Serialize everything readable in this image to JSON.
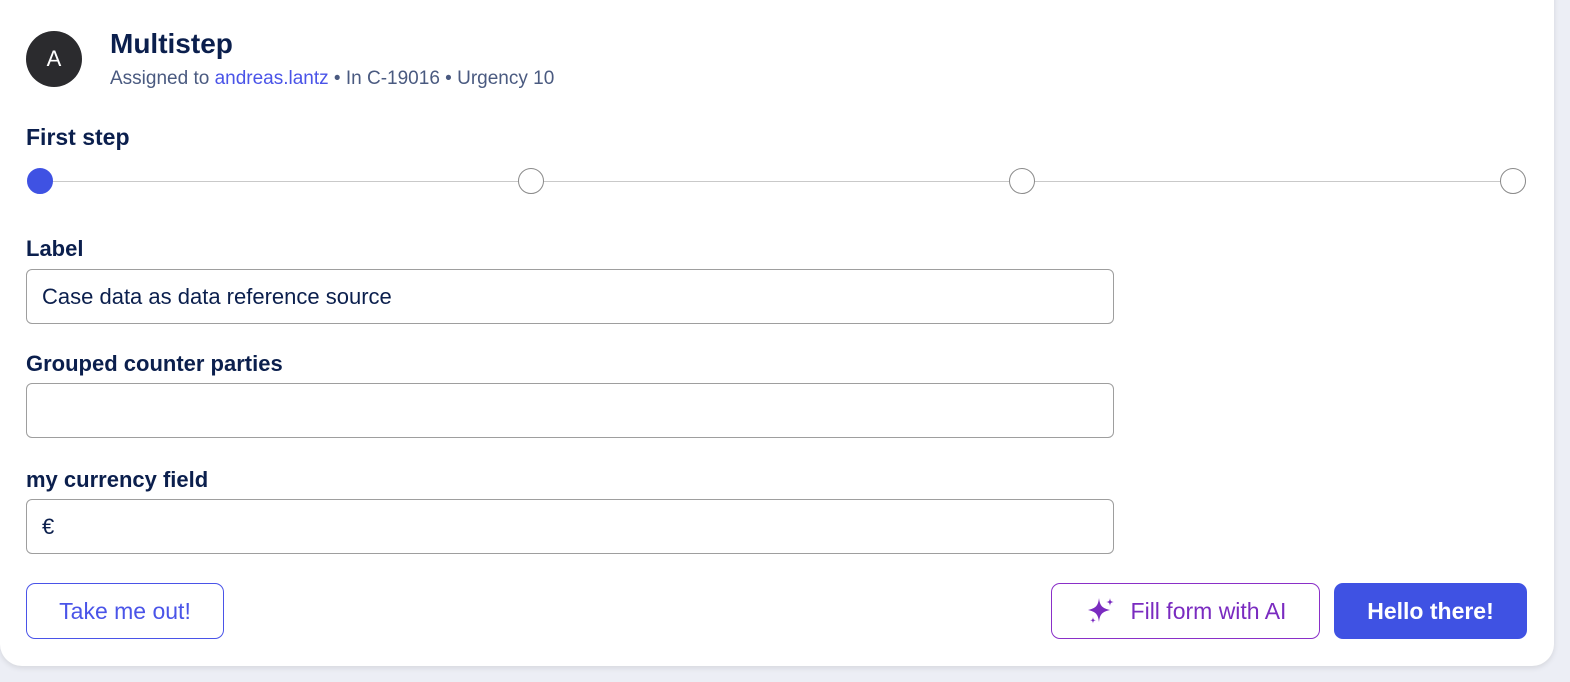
{
  "header": {
    "avatar_initial": "A",
    "title": "Multistep",
    "assigned_prefix": "Assigned to ",
    "assignee": "andreas.lantz",
    "separator1": " • ",
    "case_ref": "In C-19016",
    "separator2": " • ",
    "urgency": "Urgency 10"
  },
  "stepper": {
    "current_step_title": "First step",
    "steps_count": 4,
    "active_index": 0,
    "active_color": "#3f52e3"
  },
  "form": {
    "label_field": {
      "label": "Label",
      "value": "Case data as data reference source"
    },
    "grouped_field": {
      "label": "Grouped counter parties",
      "value": ""
    },
    "currency_field": {
      "label": "my currency field",
      "symbol": "€",
      "value": ""
    }
  },
  "actions": {
    "take_out_label": "Take me out!",
    "fill_ai_label": "Fill form with AI",
    "primary_label": "Hello there!"
  },
  "colors": {
    "accent": "#3f52e3",
    "ai_purple": "#7a2bc0",
    "title_navy": "#0b1f4d"
  }
}
